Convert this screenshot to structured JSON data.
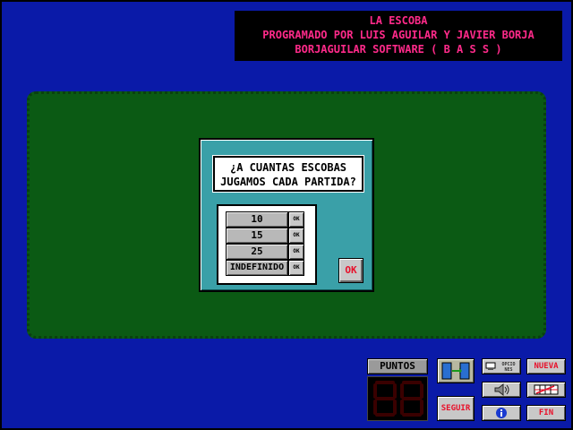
{
  "banner": {
    "line1": "LA ESCOBA",
    "line2": "PROGRAMADO POR LUIS AGUILAR Y JAVIER BORJA",
    "line3": "BORJAGUILAR SOFTWARE  ( B A S S )"
  },
  "dialog": {
    "question_line1": "¿A CUANTAS ESCOBAS",
    "question_line2": "JUGAMOS CADA PARTIDA?",
    "options": [
      {
        "label": "10",
        "ok": "OK"
      },
      {
        "label": "15",
        "ok": "OK"
      },
      {
        "label": "25",
        "ok": "OK"
      },
      {
        "label": "INDEFINIDO",
        "ok": "OK"
      }
    ],
    "confirm_label": "OK"
  },
  "controls": {
    "puntos_label": "PUNTOS",
    "puntos_value": "88",
    "seguir_label": "SEGUIR",
    "opciones_label": "OPCIO NES",
    "nueva_label": "NUEVA",
    "fin_label": "FIN"
  },
  "colors": {
    "background": "#0a1aa8",
    "felt": "#0b5a14",
    "dialog": "#3aa0a8",
    "banner_text": "#ff2a8a",
    "accent_red": "#e8102a"
  }
}
